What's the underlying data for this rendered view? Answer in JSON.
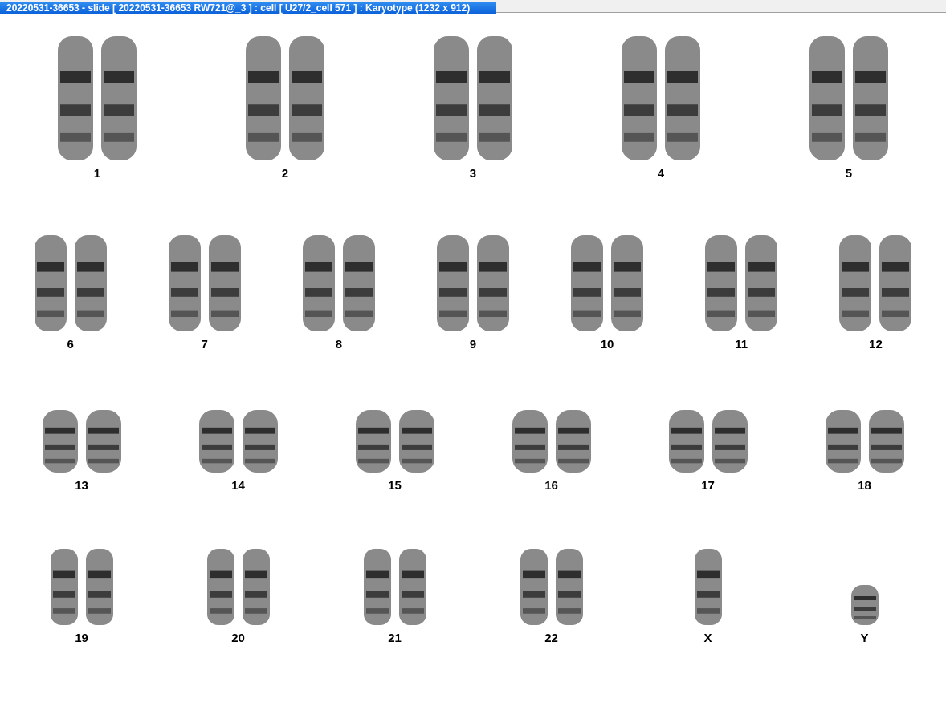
{
  "window": {
    "title": "20220531-36653 - slide [ 20220531-36653 RW721@_3 ] : cell [ U27/2_cell 571 ] : Karyotype  (1232 x 912)"
  },
  "karyotype": {
    "rows": [
      {
        "items": [
          {
            "label": "1",
            "kind": "pair"
          },
          {
            "label": "2",
            "kind": "pair"
          },
          {
            "label": "3",
            "kind": "pair"
          },
          {
            "label": "4",
            "kind": "pair"
          },
          {
            "label": "5",
            "kind": "pair"
          }
        ]
      },
      {
        "items": [
          {
            "label": "6",
            "kind": "pair"
          },
          {
            "label": "7",
            "kind": "pair"
          },
          {
            "label": "8",
            "kind": "pair"
          },
          {
            "label": "9",
            "kind": "pair"
          },
          {
            "label": "10",
            "kind": "pair"
          },
          {
            "label": "11",
            "kind": "pair"
          },
          {
            "label": "12",
            "kind": "pair"
          }
        ]
      },
      {
        "items": [
          {
            "label": "13",
            "kind": "pair"
          },
          {
            "label": "14",
            "kind": "pair"
          },
          {
            "label": "15",
            "kind": "pair"
          },
          {
            "label": "16",
            "kind": "pair"
          },
          {
            "label": "17",
            "kind": "pair"
          },
          {
            "label": "18",
            "kind": "pair"
          }
        ]
      },
      {
        "items": [
          {
            "label": "19",
            "kind": "pair"
          },
          {
            "label": "20",
            "kind": "pair"
          },
          {
            "label": "21",
            "kind": "pair"
          },
          {
            "label": "22",
            "kind": "pair"
          },
          {
            "label": "X",
            "kind": "single"
          },
          {
            "label": "Y",
            "kind": "single"
          }
        ]
      }
    ]
  }
}
